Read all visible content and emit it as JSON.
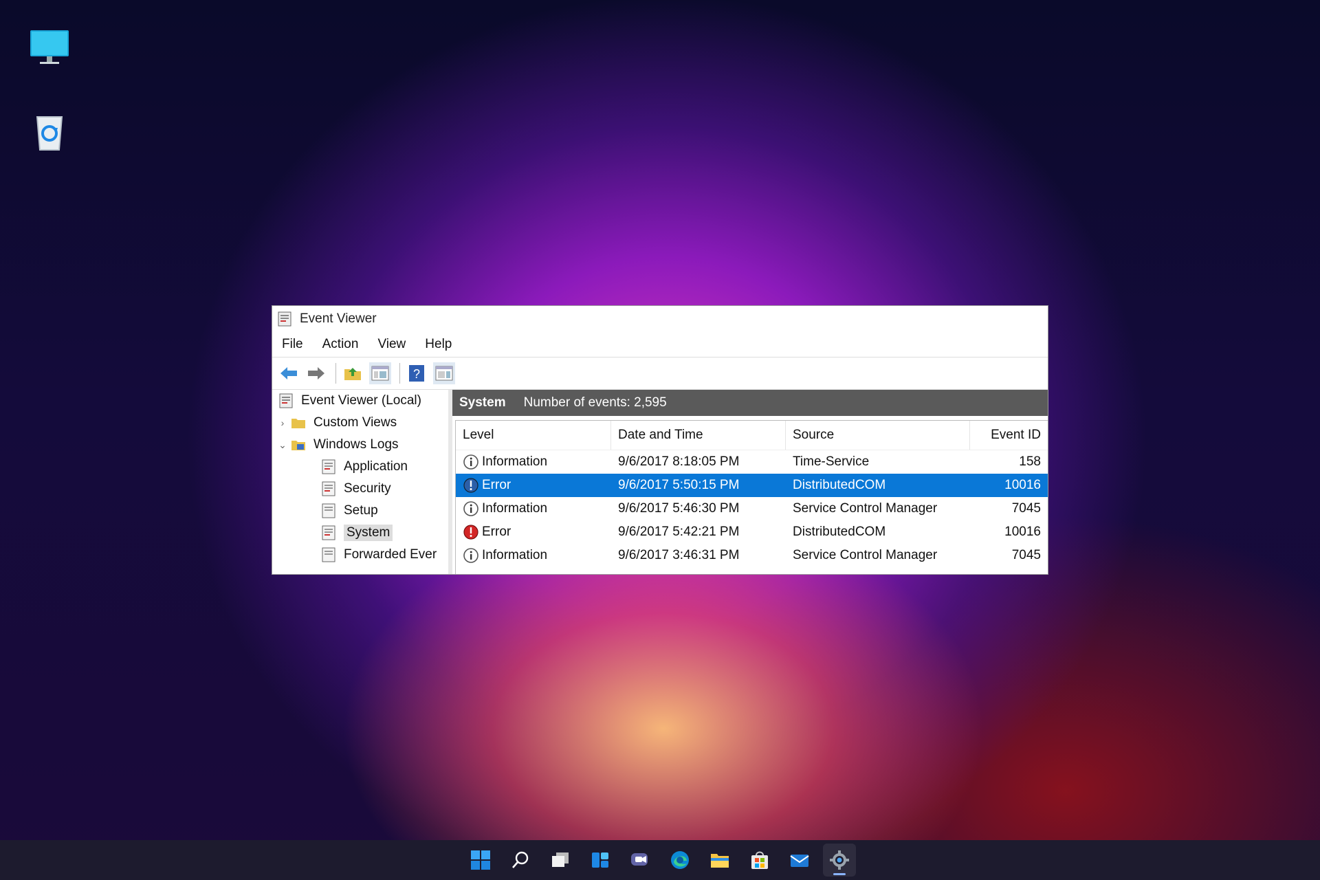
{
  "desktop": {
    "icons": [
      {
        "name": "monitor-icon"
      },
      {
        "name": "recycle-bin-icon"
      }
    ]
  },
  "window": {
    "title": "Event Viewer",
    "menu": [
      "File",
      "Action",
      "View",
      "Help"
    ],
    "toolbar": [
      "back-arrow-icon",
      "forward-arrow-icon",
      "folder-up-icon",
      "show-hide-tree-icon",
      "help-icon",
      "action-pane-icon"
    ]
  },
  "tree": {
    "root": "Event Viewer (Local)",
    "custom_views": "Custom Views",
    "windows_logs": "Windows Logs",
    "logs": [
      "Application",
      "Security",
      "Setup",
      "System",
      "Forwarded Ever"
    ],
    "selected": "System"
  },
  "pane": {
    "log_name": "System",
    "event_count": "Number of events: 2,595",
    "columns": [
      "Level",
      "Date and Time",
      "Source",
      "Event ID"
    ],
    "rows": [
      {
        "level": "Information",
        "date": "9/6/2017 8:18:05 PM",
        "source": "Time-Service",
        "id": "158"
      },
      {
        "level": "Error",
        "date": "9/6/2017 5:50:15 PM",
        "source": "DistributedCOM",
        "id": "10016"
      },
      {
        "level": "Information",
        "date": "9/6/2017 5:46:30 PM",
        "source": "Service Control Manager",
        "id": "7045"
      },
      {
        "level": "Error",
        "date": "9/6/2017 5:42:21 PM",
        "source": "DistributedCOM",
        "id": "10016"
      },
      {
        "level": "Information",
        "date": "9/6/2017 3:46:31 PM",
        "source": "Service Control Manager",
        "id": "7045"
      }
    ],
    "selected_row": 1
  },
  "taskbar": [
    "start-icon",
    "search-icon",
    "task-view-icon",
    "widgets-icon",
    "teams-chat-icon",
    "edge-icon",
    "file-explorer-icon",
    "store-icon",
    "mail-icon",
    "settings-icon"
  ],
  "colors": {
    "selection": "#0a78d7",
    "pane_header": "#5a5a5a",
    "taskbar": "#1d1b2e"
  }
}
